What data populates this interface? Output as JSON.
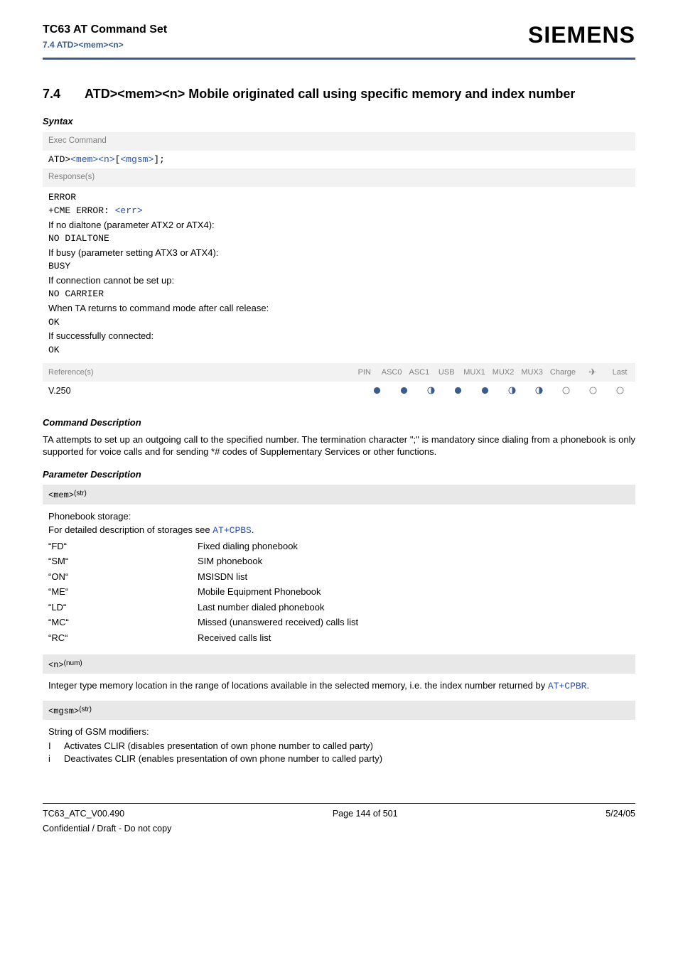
{
  "header": {
    "doc_title": "TC63 AT Command Set",
    "doc_sub": "7.4 ATD><mem><n>",
    "logo": "SIEMENS"
  },
  "section": {
    "num": "7.4",
    "title": "ATD><mem><n>   Mobile originated call using specific memory and index number"
  },
  "syntax_label": "Syntax",
  "exec_label": "Exec Command",
  "cmd": {
    "base": "ATD>",
    "arg1": "<mem>",
    "arg2": "<n>",
    "lb": "[",
    "arg3": "<mgsm>",
    "rb": "];"
  },
  "responses_label": "Response(s)",
  "resp": {
    "error": "ERROR",
    "cme_prefix": "+CME ERROR: ",
    "cme_arg": "<err>",
    "nodial_intro": "If no dialtone (parameter ATX2 or ATX4):",
    "nodial": "NO DIALTONE",
    "busy_intro": "If busy (parameter setting ATX3 or ATX4):",
    "busy": "BUSY",
    "noconn_intro": "If connection cannot be set up:",
    "nocarrier": "NO CARRIER",
    "cmdmode_intro": "When TA returns to command mode after call release:",
    "ok1": "OK",
    "conn_intro": "If successfully connected:",
    "ok2": "OK"
  },
  "refs": {
    "label": "Reference(s)",
    "cols": [
      "PIN",
      "ASC0",
      "ASC1",
      "USB",
      "MUX1",
      "MUX2",
      "MUX3",
      "Charge",
      "✈",
      "Last"
    ],
    "name": "V.250",
    "vals": [
      "full",
      "full",
      "half",
      "full",
      "full",
      "half",
      "half",
      "empty",
      "empty",
      "empty"
    ]
  },
  "cmd_desc_label": "Command Description",
  "cmd_desc": "TA attempts to set up an outgoing call to the specified number. The termination character \";\" is mandatory since dialing from a phonebook is only supported for voice calls and for sending *# codes of Supplementary Services or other functions.",
  "param_desc_label": "Parameter Description",
  "param_mem": {
    "name": "<mem>",
    "sup": "(str)",
    "intro1": "Phonebook storage:",
    "intro2_pre": "For detailed description of storages see ",
    "intro2_link": "AT+CPBS",
    "intro2_post": ".",
    "rows": [
      {
        "k": "“FD“",
        "v": "Fixed dialing phonebook"
      },
      {
        "k": "“SM“",
        "v": "SIM phonebook"
      },
      {
        "k": "“ON“",
        "v": "MSISDN list"
      },
      {
        "k": "“ME“",
        "v": "Mobile Equipment Phonebook"
      },
      {
        "k": "“LD“",
        "v": "Last number dialed phonebook"
      },
      {
        "k": "“MC“",
        "v": "Missed (unanswered received) calls list"
      },
      {
        "k": "“RC“",
        "v": "Received calls list"
      }
    ]
  },
  "param_n": {
    "name": "<n>",
    "sup": "(num)",
    "desc_pre": "Integer type memory location in the range of locations available in the selected memory, i.e. the index number returned by ",
    "desc_link": "AT+CPBR",
    "desc_post": "."
  },
  "param_mgsm": {
    "name": "<mgsm>",
    "sup": "(str)",
    "intro": "String of GSM modifiers:",
    "rows": [
      {
        "k": "I",
        "v": "Activates CLIR (disables presentation of own phone number to called party)"
      },
      {
        "k": "i",
        "v": "Deactivates CLIR (enables presentation of own phone number to called party)"
      }
    ]
  },
  "footer": {
    "left": "TC63_ATC_V00.490",
    "center": "Page 144 of 501",
    "right": "5/24/05",
    "sub": "Confidential / Draft - Do not copy"
  }
}
